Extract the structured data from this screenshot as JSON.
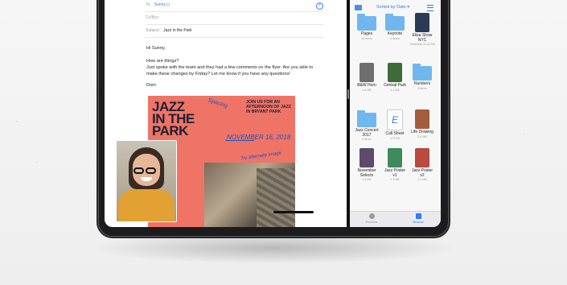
{
  "mail": {
    "to_label": "To:",
    "to_value": "Sunny Li",
    "ccbcc_label": "Cc/Bcc:",
    "subject_label": "Subject:",
    "subject_value": "Jazz in the Park",
    "greeting": "Hi Sunny,",
    "line1": "How are things?",
    "line2": "Just spoke with the team and they had a few comments on the flyer. Are you able to make these changes by Friday? Let me know if you have any questions!",
    "signature": "Dom"
  },
  "poster": {
    "title_line1": "JAZZ",
    "title_line2": "IN THE",
    "title_line3": "PARK",
    "info": "JOIN US FOR AN AFTERNOON OF JAZZ IN BRYANT PARK",
    "annotation_spacing": "Spacing",
    "annotation_date": "NOVEMBER 16, 2018",
    "annotation_image": "Try alternate image"
  },
  "files": {
    "sort_label": "Sorted by Date ▾",
    "items": [
      {
        "name": "Pages",
        "sub": "15 items",
        "kind": "folder"
      },
      {
        "name": "Keynote",
        "sub": "4 items",
        "kind": "folder"
      },
      {
        "name": "Eliza Show NYC",
        "sub": "Yesterday 11:52 AM",
        "kind": "thumb",
        "color": "#2b3a57"
      },
      {
        "name": "B&W Horn",
        "sub": "1.6 MB",
        "kind": "thumb",
        "color": "#6f6f6f"
      },
      {
        "name": "Central Park",
        "sub": "1.1 MB",
        "kind": "thumb",
        "color": "#3f6b3a"
      },
      {
        "name": "Numbers",
        "sub": "5 items",
        "kind": "folder"
      },
      {
        "name": "Jazz Concert 2017",
        "sub": "5 items",
        "kind": "folder"
      },
      {
        "name": "Call Sheet",
        "sub": "170 KB",
        "kind": "doc",
        "color": "#ffffff"
      },
      {
        "name": "Life Drawing",
        "sub": "2.5 MB",
        "kind": "thumb",
        "color": "#a45c3c"
      },
      {
        "name": "November Selects",
        "sub": "1.4 MB",
        "kind": "thumb",
        "color": "#5c4b6b"
      },
      {
        "name": "Jazz Poster v1",
        "sub": "2.1 MB",
        "kind": "thumb",
        "color": "#3d8a5c"
      },
      {
        "name": "Jazz Poster v2",
        "sub": "2.2 MB",
        "kind": "thumb",
        "color": "#b84a3e"
      }
    ],
    "tabs": [
      {
        "label": "Recents"
      },
      {
        "label": "Browse"
      }
    ]
  },
  "colors": {
    "accent": "#2f7cf6",
    "poster_bg": "#ef7466"
  }
}
